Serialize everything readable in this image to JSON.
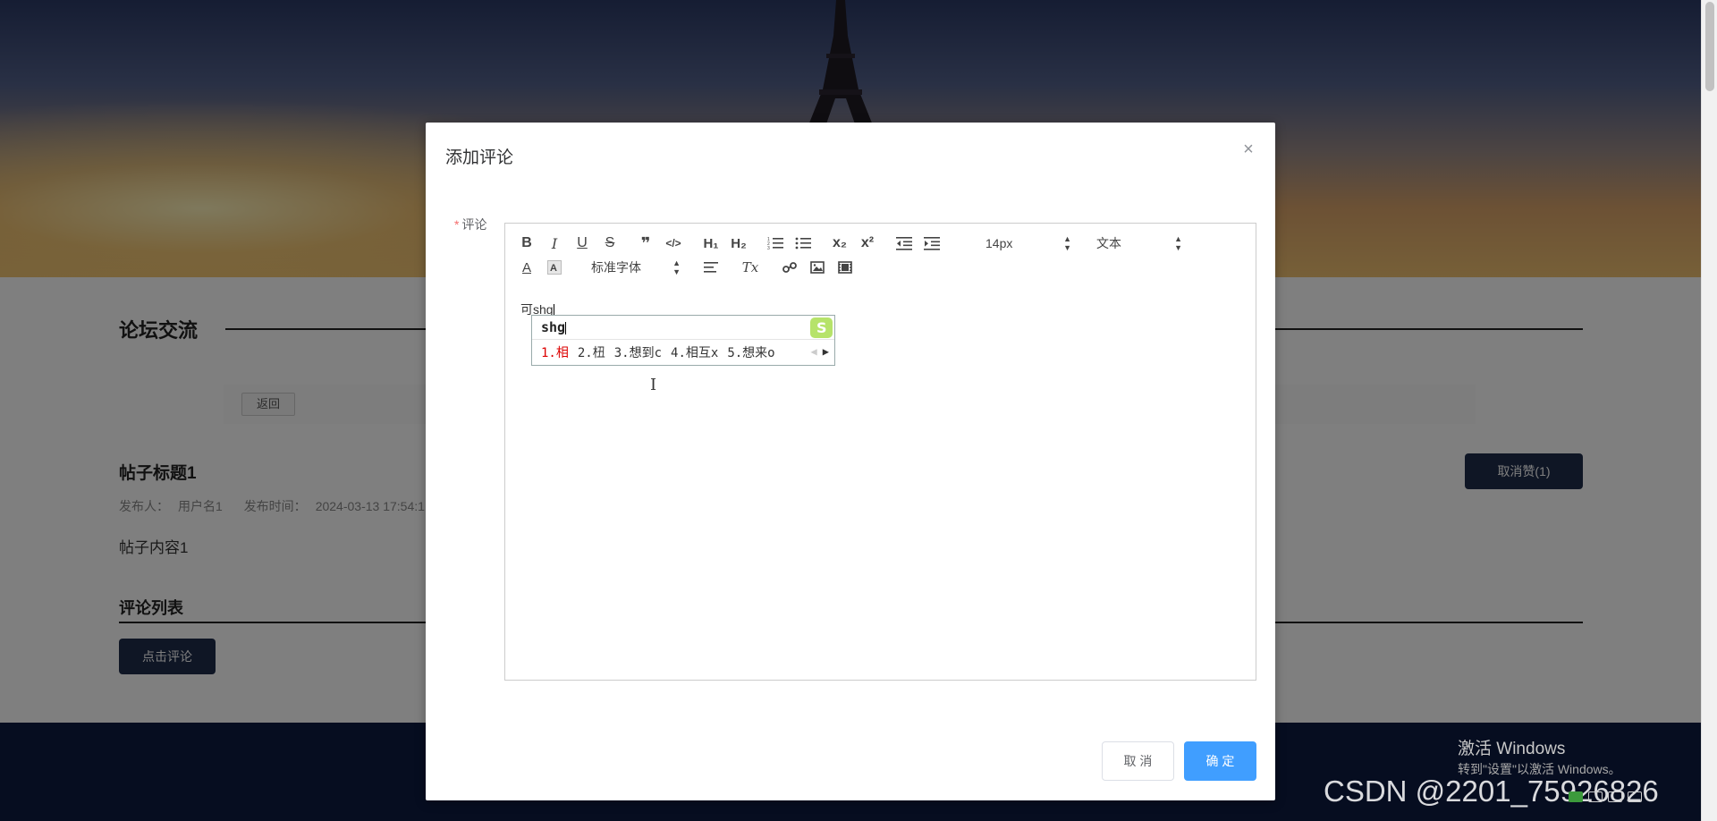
{
  "page": {
    "section_title": "论坛交流",
    "back_label": "返回",
    "post_title": "帖子标题1",
    "post_meta": {
      "author_label": "发布人：",
      "author": "用户名1",
      "time_label": "发布时间：",
      "time": "2024-03-13 17:54:1"
    },
    "post_content": "帖子内容1",
    "unlike_label": "取消赞(1)",
    "comment_list_title": "评论列表",
    "add_comment_label": "点击评论"
  },
  "dialog": {
    "title": "添加评论",
    "close_symbol": "×",
    "field_required_mark": "*",
    "field_label": "评论",
    "cancel_label": "取 消",
    "confirm_label": "确 定"
  },
  "editor": {
    "toolbar": {
      "bold": "B",
      "italic": "I",
      "underline": "U",
      "strike": "S",
      "blockquote": "❞",
      "code": "</>",
      "h1": "H₁",
      "h2": "H₂",
      "subscript": "x₂",
      "superscript": "x²",
      "size_value": "14px",
      "header_value": "文本",
      "font_color": "A",
      "font_family_value": "标准字体",
      "clean": "Tx"
    },
    "content_text": "可shg"
  },
  "ime": {
    "input": "shg",
    "candidates": [
      "1.相",
      "2.杻",
      "3.想到c",
      "4.相互x",
      "5.想来o"
    ]
  },
  "watermark": {
    "windows_title": "激活 Windows",
    "windows_sub": "转到\"设置\"以激活 Windows。",
    "csdn": "CSDN @2201_75926826"
  },
  "colors": {
    "primary": "#409eff",
    "dark_button": "#1f2c4a",
    "required": "#f56c6c",
    "footer": "#0c1a40"
  }
}
